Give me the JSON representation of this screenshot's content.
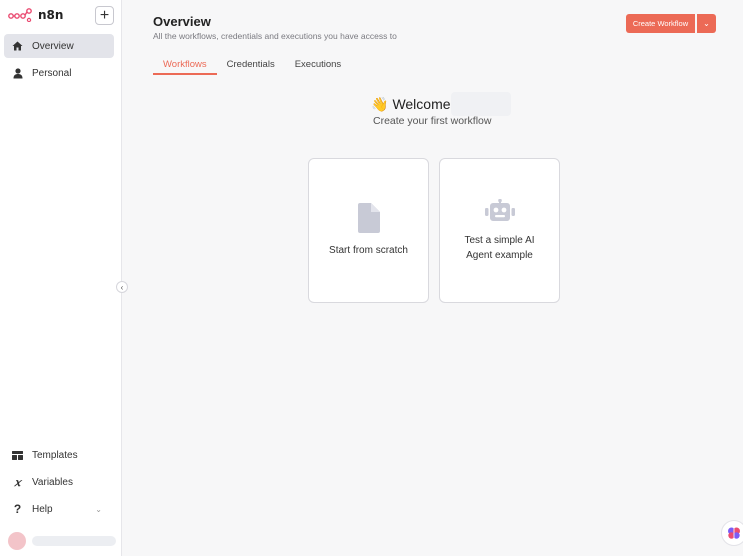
{
  "sidebar": {
    "brand": "n8n",
    "add_label": "+",
    "nav": [
      {
        "label": "Overview",
        "icon": "home-icon"
      },
      {
        "label": "Personal",
        "icon": "user-icon"
      }
    ],
    "bottom": [
      {
        "label": "Templates",
        "icon": "templates-icon"
      },
      {
        "label": "Variables",
        "icon": "variables-icon"
      },
      {
        "label": "Help",
        "icon": "help-icon"
      }
    ]
  },
  "header": {
    "title": "Overview",
    "subtitle": "All the workflows, credentials and executions you have access to",
    "create_label": "Create Workflow"
  },
  "tabs": [
    {
      "label": "Workflows",
      "active": true
    },
    {
      "label": "Credentials",
      "active": false
    },
    {
      "label": "Executions",
      "active": false
    }
  ],
  "welcome": {
    "wave": "👋",
    "title": "Welcome",
    "subtitle": "Create your first workflow"
  },
  "cards": [
    {
      "label": "Start from scratch",
      "icon": "file-icon"
    },
    {
      "label": "Test a simple AI Agent example",
      "icon": "robot-icon"
    }
  ],
  "colors": {
    "accent": "#ec6a56",
    "active_nav": "#e3e4ea",
    "icon_grey": "#c8cad6"
  }
}
